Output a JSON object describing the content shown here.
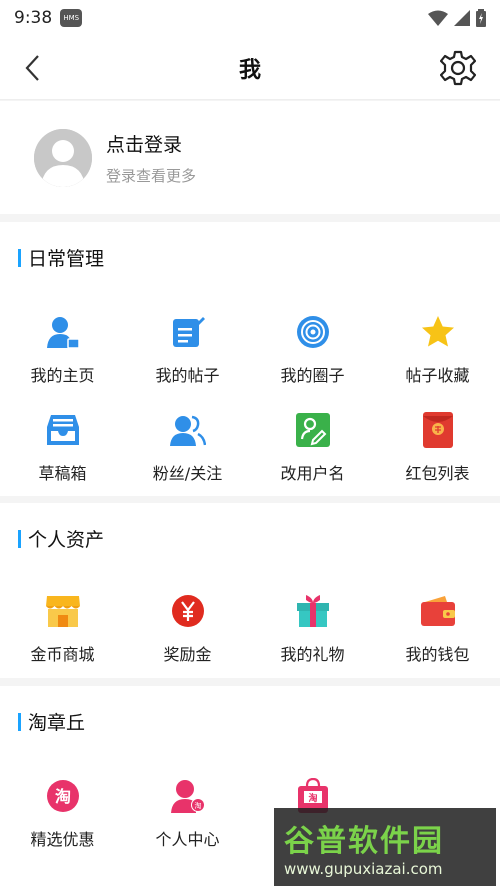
{
  "status": {
    "time": "9:38",
    "badge": "HMS"
  },
  "nav": {
    "title": "我"
  },
  "profile": {
    "login_label": "点击登录",
    "login_sub": "登录查看更多"
  },
  "sections": {
    "daily": {
      "title": "日常管理",
      "items": [
        {
          "label": "我的主页",
          "icon": "user-home-icon"
        },
        {
          "label": "我的帖子",
          "icon": "post-edit-icon"
        },
        {
          "label": "我的圈子",
          "icon": "circle-target-icon"
        },
        {
          "label": "帖子收藏",
          "icon": "star-icon"
        },
        {
          "label": "草稿箱",
          "icon": "inbox-tray-icon"
        },
        {
          "label": "粉丝/关注",
          "icon": "followers-icon"
        },
        {
          "label": "改用户名",
          "icon": "rename-icon"
        },
        {
          "label": "红包列表",
          "icon": "red-envelope-icon"
        }
      ]
    },
    "assets": {
      "title": "个人资产",
      "items": [
        {
          "label": "金币商城",
          "icon": "shop-icon"
        },
        {
          "label": "奖励金",
          "icon": "yen-coin-icon"
        },
        {
          "label": "我的礼物",
          "icon": "gift-icon"
        },
        {
          "label": "我的钱包",
          "icon": "wallet-icon"
        }
      ]
    },
    "taobao": {
      "title": "淘章丘",
      "items": [
        {
          "label": "精选优惠",
          "icon": "tao-badge-icon"
        },
        {
          "label": "个人中心",
          "icon": "tao-person-icon"
        },
        {
          "label": "",
          "icon": "tao-bag-icon"
        }
      ]
    }
  },
  "watermark": {
    "brand": "谷普软件园",
    "url": "www.gupuxiazai.com"
  },
  "colors": {
    "accent": "#1aa3ff",
    "blue_icon": "#2f8fe8",
    "star": "#f7c316",
    "green": "#3ab14a",
    "red": "#e03a2f",
    "pink": "#e8336a"
  }
}
